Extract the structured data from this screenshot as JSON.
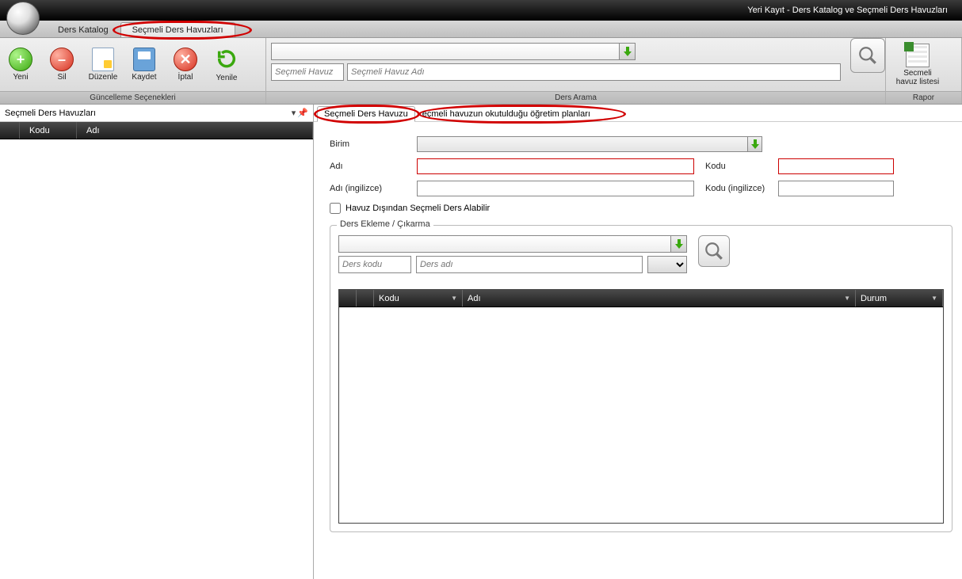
{
  "window": {
    "title": "Yeri Kayıt - Ders Katalog ve Seçmeli Ders Havuzları"
  },
  "topTabs": {
    "catalog": "Ders Katalog",
    "pools": "Seçmeli Ders Havuzları"
  },
  "ribbon": {
    "group1_label": "Güncelleme Seçenekleri",
    "group2_label": "Ders Arama",
    "group3_label": "Rapor",
    "btn_new": "Yeni",
    "btn_del": "Sil",
    "btn_edit": "Düzenle",
    "btn_save": "Kaydet",
    "btn_cancel": "İptal",
    "btn_refresh": "Yenile",
    "btn_report": "Secmeli\nhavuz listesi",
    "ph_pool": "Seçmeli Havuz",
    "ph_poolname": "Seçmeli Havuz Adı"
  },
  "left": {
    "title": "Seçmeli Ders Havuzları",
    "col_code": "Kodu",
    "col_name": "Adı"
  },
  "rightTabs": {
    "t1": "Seçmeli Ders Havuzu",
    "t2": "eçmeli havuzun okutulduğu öğretim planları"
  },
  "form": {
    "birim": "Birim",
    "adi": "Adı",
    "kodu": "Kodu",
    "adi_en": "Adı (ingilizce)",
    "kodu_en": "Kodu (ingilizce)",
    "checkbox": "Havuz Dışından Seçmeli Ders Alabilir"
  },
  "courses": {
    "legend": "Ders Ekleme / Çıkarma",
    "ph_code": "Ders kodu",
    "ph_name": "Ders adı",
    "col_code": "Kodu",
    "col_name": "Adı",
    "col_status": "Durum"
  }
}
